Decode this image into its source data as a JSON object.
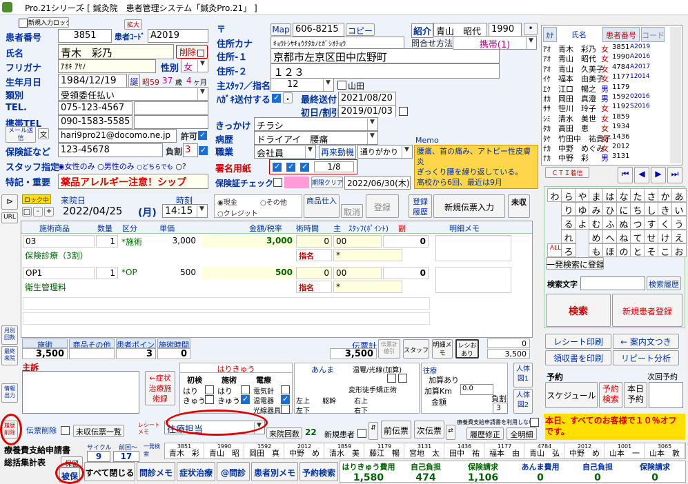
{
  "titlebar": {
    "app": "Pro.21シリーズ",
    "title": "- [ 鍼灸院　患者管理システム「鍼灸Pro.21」 ]"
  },
  "patient": {
    "id_label": "患者番号",
    "id": "3851",
    "code_label": "患者ｺｰﾄﾞ",
    "code": "A2019",
    "name_label": "氏名",
    "name": "青木　彩乃",
    "delete_label": "削除",
    "kana_label": "フリガナ",
    "kana": "ｱｵｷ ｱﾔﾉ",
    "sex_label": "性別",
    "sex": "女",
    "birth_label": "生年月日",
    "birth": "1984/12/19",
    "birth_btn": "誕",
    "era": "昭59",
    "age": "37",
    "age_unit": "歳",
    "months": "4",
    "months_unit": "ヶ月",
    "type_label": "類別",
    "type": "受領委任払い",
    "tel_label": "TEL.",
    "tel": "075-123-4567",
    "mobile_label": "携帯TEL",
    "mobile": "090-1583-5585",
    "mail_btn": "メール送信",
    "mail_icon": "文",
    "email": "hari9pro21@docomo.ne.jp",
    "allow_label": "許可",
    "ins_label": "保険証など",
    "ins": "123-45678",
    "burden_label": "負割",
    "burden": "3",
    "staff_label": "スタッフ指定",
    "staff_opts": [
      "女性のみ",
      "男性のみ",
      "どちらでも"
    ],
    "notes_label": "特記・重要",
    "notes": "薬品アレルギー注意！シップ",
    "top_btns": [
      "新規入力ロック",
      "拡大"
    ]
  },
  "address": {
    "zip_label": "〒",
    "map_btn": "Map",
    "zip": "606-8215",
    "copy_btn": "コピー",
    "addr_kana_label": "住所カナ",
    "addr_kana": "ｷｮｳﾄｼｻｷｮｳｸﾀｶﾉﾋｶﾞｼｵﾁｮｳ",
    "addr1_label": "住所-１",
    "addr1": "京都市左京区田中広野町",
    "addr2_label": "住所-２",
    "addr2": "１２３",
    "staff_label": "主ｽﾀｯﾌ／指名",
    "staff": "12",
    "staff_name": "山田",
    "postcard_label": "ﾊｶﾞｷ送付する",
    "last_sent_label": "最終送付",
    "last_sent": "2021/08/20",
    "first_label": "初日/割引",
    "first": "2019/01/03",
    "referral_label": "紹介",
    "referral": "青山　昭代",
    "referral_id": "1990",
    "contact_label": "問合せ方法",
    "contact": "携帯(1)"
  },
  "trigger": {
    "label": "きっかけ",
    "value": "チラシ",
    "disease_label": "病歴",
    "disease": "ドライアイ　腰痛",
    "job_label": "職業",
    "job": "会社員",
    "revisit_label": "再来動機",
    "revisit": "通りがかり",
    "sign_label": "署名用紙",
    "sign_count": "1/8",
    "ins_check_label": "保険証チェック",
    "expiry_btn": "期限クリア",
    "expiry": "2022/06/30(木)",
    "memo_label": "Memo",
    "memo": "腰痛、首の痛み、アトピー性皮膚炎\nぎっくり腰を繰り返している。\n高校から6回、最近は9月"
  },
  "patient_list": {
    "headers": [
      "ｶﾅ",
      "氏名",
      "患者番号",
      "コード"
    ],
    "rows": [
      [
        "ｱｵ",
        "青木　彩乃",
        "女",
        "3851",
        "A2019"
      ],
      [
        "ｱｵ",
        "青山　昭代",
        "女",
        "1990",
        "A2016"
      ],
      [
        "ｱｵ",
        "青山　久美子",
        "女",
        "4784",
        "A2017"
      ],
      [
        "ｲｹ",
        "福本　由美子",
        "女",
        "1177",
        "12014"
      ],
      [
        "ｴｸ",
        "江口　暢之",
        "男",
        "1179",
        ""
      ],
      [
        "ｵｶ",
        "岡田　真澄",
        "男",
        "1592",
        "02016"
      ],
      [
        "ｻｻ",
        "笹川　玲子",
        "女",
        "1192",
        "S2016"
      ],
      [
        "ｼﾐ",
        "清水　美世",
        "女",
        "1859",
        ""
      ],
      [
        "ﾀｶ",
        "高田　恵",
        "女",
        "1934",
        ""
      ],
      [
        "ﾀｹ",
        "竹田中　祐貴子",
        "女",
        "1436",
        ""
      ],
      [
        "ﾅｶ",
        "中野　めぐみ",
        "女",
        "2012",
        ""
      ],
      [
        "ﾅｶ",
        "中野　彩",
        "男",
        "3131",
        ""
      ]
    ],
    "cti_btn": "ＣＴＩ着信"
  },
  "kana_keys": [
    "わ",
    "ら",
    "や",
    "ま",
    "は",
    "な",
    "た",
    "さ",
    "か",
    "あ",
    "",
    "り",
    "ゆ",
    "み",
    "ひ",
    "に",
    "ち",
    "し",
    "き",
    "い",
    "",
    "る",
    "よ",
    "む",
    "ふ",
    "ぬ",
    "つ",
    "す",
    "く",
    "う",
    "",
    "れ",
    "",
    "め",
    "へ",
    "ね",
    "て",
    "せ",
    "け",
    "え",
    "ALL",
    "ろ",
    "",
    "も",
    "ほ",
    "の",
    "と",
    "そ",
    "こ",
    "お"
  ],
  "search": {
    "oneshot_btn": "一発検索に登録",
    "label": "検索文字",
    "history_btn": "検索履歴",
    "search_btn": "検索",
    "new_patient_btn": "新規患者登録"
  },
  "right_btns": {
    "receipt_print": "レシート印刷",
    "guide_card": "← 案内文つき",
    "receipt_print2": "領収書を印刷",
    "repeat": "リピート分析"
  },
  "reserve": {
    "label": "予約",
    "next_label": "次回予約",
    "schedule_btn": "スケジュール",
    "reserve_search_btn": "予約検索",
    "today_btn": "本日予約",
    "banner": "本日、すべてのお客様で１０％オフです。"
  },
  "visit": {
    "lock_label": "ロック中",
    "date_label": "来院日",
    "date": "2022/04/25",
    "dow": "(月)",
    "time_label": "時刻",
    "time": "14:15",
    "cash": "現金",
    "credit": "クレジット",
    "other": "その他",
    "goods_btn": "商品仕入",
    "cancel_btn": "取消",
    "register_btn": "登録",
    "register_hist_btn": "登録履歴",
    "new_slip_btn": "新規伝票入力",
    "unpaid_btn": "未収"
  },
  "items": {
    "headers": [
      "施術商品",
      "数量",
      "区分",
      "単価",
      "金額/税率",
      "術時間",
      "主",
      "ｽﾀｯﾌ(ﾎﾟｲﾝﾄ)",
      "副",
      "明細メモ"
    ],
    "rows": [
      {
        "code": "03",
        "qty": "1",
        "cat": "*施術",
        "price": "3,000",
        "amount": "3,000",
        "time": "0",
        "main": "00",
        "pt": "0",
        "name": "保険診療（3割）",
        "nominate": "指名",
        "star": "*"
      },
      {
        "code": "OP1",
        "qty": "1",
        "cat": "*OP",
        "price": "500",
        "amount": "500",
        "time": "0",
        "main": "00",
        "pt": "0",
        "name": "衛生管理料",
        "nominate": "指名",
        "star": "*"
      }
    ]
  },
  "totals": {
    "h1": "施術",
    "h2": "商品その他",
    "h3": "患者ポイント",
    "h4": "施術時間",
    "v1": "3,500",
    "v2": "",
    "v3": "3",
    "v4": "0",
    "slip_label": "伝票計",
    "slip": "3,500",
    "slip_print": "伝票計値引",
    "staff_btn": "スタッフ",
    "memo_btn": "明細メモ",
    "receipt_btn": "レシおあり",
    "pts": "0",
    "pts2": "3,500"
  },
  "complaint": {
    "label": "主訴",
    "symptom_btn": "←症状治療施術録",
    "hari_label": "はりきゅう",
    "c1": "初検",
    "c2": "施術",
    "c3": "電療",
    "hari": "はり",
    "kyu": "きゅう",
    "hk": "はりきゅう",
    "denshin": "電気針",
    "ondan": "温電器",
    "kosen": "光線器具",
    "anma": "あんま",
    "onshitsu": "温罨/光線(加算)",
    "henkei": "変形徒手矯正術",
    "left_up": "左上",
    "kansetsu": "躯幹",
    "right_up": "右上",
    "left_down": "左下",
    "right_down": "右下",
    "oshin": "往療",
    "kasan": "加算あり",
    "km": "加算Km",
    "km_val": "0.0",
    "money": "金額",
    "burden": "負割",
    "burden_val": "3",
    "person1": "人体図1",
    "person2": "人体図2"
  },
  "bottom": {
    "history_btn": "履歴削除",
    "slip_del": "伝票削除",
    "unpaid_list": "未収伝票一覧",
    "receipt_label": "レシート\nメモ",
    "staff_select": "往療担当",
    "visits_label": "来院回数",
    "visits": "22",
    "new_patient": "新規患者",
    "prev_slip": "前伝票",
    "next_slip": "次伝票",
    "app_use": "療養費支給申請書を利用しない",
    "history_edit": "履歴修正",
    "all_edit": "全明細",
    "app_form": "療養費支給申請書",
    "summary": "総括集計表",
    "pending": "保留",
    "cycle_label": "サイクル",
    "cycle": "9",
    "prev_label": "前回～",
    "prev": "17",
    "oneshot_label": "一発検索",
    "close_all": "すべて閉じる",
    "hoken": "被保",
    "interview": "問診メモ",
    "symptom": "症状治療",
    "at_interview": "@問診",
    "per_patient": "患者別メモ",
    "reserve_search": "予約検索",
    "fees": [
      {
        "label": "はりきゅう費用",
        "value": "1,580"
      },
      {
        "label": "自己負担",
        "value": "474"
      },
      {
        "label": "保険請求",
        "value": "1,106"
      },
      {
        "label": "あんま費用",
        "value": "0"
      },
      {
        "label": "自己負担",
        "value": "0"
      },
      {
        "label": "保険請求",
        "value": "0"
      }
    ],
    "patient_bar": [
      {
        "id": "3851",
        "name": "青木　彩"
      },
      {
        "id": "1990",
        "name": "青山　昭"
      },
      {
        "id": "1592",
        "name": "岡田　真"
      },
      {
        "id": "2012",
        "name": "中野　め"
      },
      {
        "id": "1859",
        "name": "清水　美"
      },
      {
        "id": "1179",
        "name": "藤江　暢"
      },
      {
        "id": "3131",
        "name": "宮地　太"
      },
      {
        "id": "1436",
        "name": "田中　祐"
      },
      {
        "id": "1177",
        "name": "福本　由"
      },
      {
        "id": "4784",
        "name": "青山　弘"
      },
      {
        "id": "2012",
        "name": "中野　め"
      },
      {
        "id": "1001",
        "name": "山本　一"
      },
      {
        "id": "3065",
        "name": "山本　敦"
      }
    ]
  },
  "side": {
    "url": "URL",
    "monthly": "月別回数",
    "last": "最終来院",
    "info": "情報出力"
  }
}
